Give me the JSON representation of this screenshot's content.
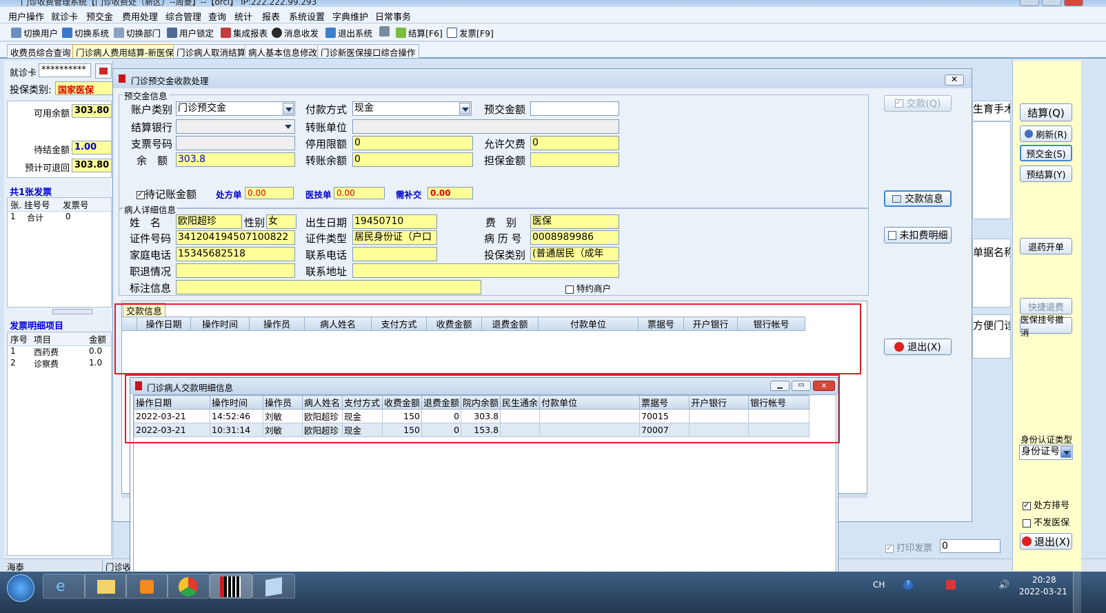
{
  "app": {
    "title": "门诊收费管理系统【门诊收费处（新区）--周菱】--【orcl】 IP:222.222.99.293"
  },
  "menu": [
    "用户操作",
    "就诊卡",
    "预交金",
    "费用处理",
    "综合管理",
    "查询",
    "统计",
    "报表",
    "系统设置",
    "字典维护",
    "日常事务"
  ],
  "toolbar": [
    "切换用户",
    "切换系统",
    "切换部门",
    "用户锁定",
    "集成报表",
    "消息收发",
    "退出系统",
    "结算[F6]",
    "发票[F9]"
  ],
  "tabs": [
    "收费员综合查询",
    "门诊病人费用结算-新医保",
    "门诊病人取消结算",
    "病人基本信息修改",
    "门诊新医保接口综合操作"
  ],
  "left": {
    "card_label": "就诊卡",
    "card_value": "**********",
    "ins_type_label": "投保类别:",
    "ins_type_value": "国家医保",
    "avail_label": "可用余额",
    "avail_value": "303.80",
    "pending_label": "待结金额",
    "pending_value": "1.00",
    "refund_label": "预计可退回",
    "refund_value": "303.80",
    "invoice_count": "共1张发票",
    "inv_cols": [
      "张.",
      "挂号号",
      "发票号"
    ],
    "inv_row": [
      "1",
      "合计",
      "0"
    ],
    "detail_title": "发票明细项目",
    "detail_cols": [
      "序号",
      "项目",
      "金额"
    ],
    "detail_rows": [
      [
        "1",
        "西药费",
        "0.0"
      ],
      [
        "2",
        "诊察费",
        "1.0"
      ]
    ],
    "status": [
      "海泰",
      "门诊收"
    ]
  },
  "right": {
    "buttons": [
      "结算(Q)",
      "刷新(R)",
      "预交金(S)",
      "预结算(Y)",
      "退药开单",
      "快捷退费",
      "医保挂号撤消",
      "退出(X)"
    ],
    "partial_texts": [
      "生育手术",
      "单据名称",
      "方便门诊"
    ],
    "id_type_label": "身份认证类型",
    "id_type_value": "身份证号",
    "chk_rx": "处方排号",
    "chk_no_ins": "不发医保",
    "print_invoice": "打印发票",
    "print_value": "0"
  },
  "dialog": {
    "title": "门诊预交金收款处理",
    "section_prepay": "预交金信息",
    "account_type_label": "账户类别",
    "account_type_value": "门诊预交金",
    "pay_method_label": "付款方式",
    "pay_method_value": "现金",
    "prepay_amount_label": "预交金额",
    "prepay_amount_value": "",
    "bank_label": "结算银行",
    "transfer_unit_label": "转账单位",
    "check_no_label": "支票号码",
    "stop_limit_label": "停用限额",
    "stop_limit_value": "0",
    "overdraft_label": "允许欠费",
    "overdraft_value": "0",
    "balance_label": "余　额",
    "balance_value": "303.8",
    "transfer_balance_label": "转账余额",
    "transfer_balance_value": "0",
    "guarantee_label": "担保金额",
    "guarantee_value": "",
    "pending_amount_label": "待记账金额",
    "rx_label": "处方单",
    "rx_value": "0.00",
    "tech_label": "医技单",
    "tech_value": "0.00",
    "need_label": "需补交",
    "need_value": "0.00",
    "section_patient": "病人详细信息",
    "name_label": "姓　名",
    "name_value": "欧阳超珍",
    "sex_label": "性别",
    "sex_value": "女",
    "dob_label": "出生日期",
    "dob_value": "19450710",
    "fee_label": "费　别",
    "fee_value": "医保",
    "id_label": "证件号码",
    "id_value": "341204194507100822",
    "id_type_label": "证件类型",
    "id_type_value": "居民身份证（户口",
    "record_label": "病 历 号",
    "record_value": "0008989986",
    "phone_label": "家庭电话",
    "phone_value": "15345682518",
    "contact_label": "联系电话",
    "ins_label": "投保类别",
    "ins_value": "(普通居民（成年",
    "retire_label": "职退情况",
    "address_label": "联系地址",
    "note_label": "标注信息",
    "special_label": "特约商户",
    "buttons": {
      "pay": "交款(Q)",
      "pay_info": "交款信息",
      "unpaid": "未扣费明细",
      "exit": "退出(X)"
    },
    "pay_tab": "交款信息",
    "pay_cols": [
      "操作日期",
      "操作时间",
      "操作员",
      "病人姓名",
      "支付方式",
      "收费金额",
      "退费金额",
      "付款单位",
      "票据号",
      "开户银行",
      "银行帐号"
    ]
  },
  "detail_dialog": {
    "title": "门诊病人交款明细信息",
    "cols": [
      "操作日期",
      "操作时间",
      "操作员",
      "病人姓名",
      "支付方式",
      "收费金额",
      "退费金额",
      "院内余额",
      "民生通余",
      "付款单位",
      "票据号",
      "开户银行",
      "银行帐号"
    ],
    "rows": [
      [
        "2022-03-21",
        "14:52:46",
        "刘敏",
        "欧阳超珍",
        "现金",
        "150",
        "0",
        "303.8",
        "",
        "",
        "70015",
        "",
        ""
      ],
      [
        "2022-03-21",
        "10:31:14",
        "刘敏",
        "欧阳超珍",
        "现金",
        "150",
        "0",
        "153.8",
        "",
        "",
        "70007",
        "",
        ""
      ]
    ]
  },
  "taskbar": {
    "lang": "CH",
    "time": "20:28",
    "date": "2022-03-21"
  }
}
